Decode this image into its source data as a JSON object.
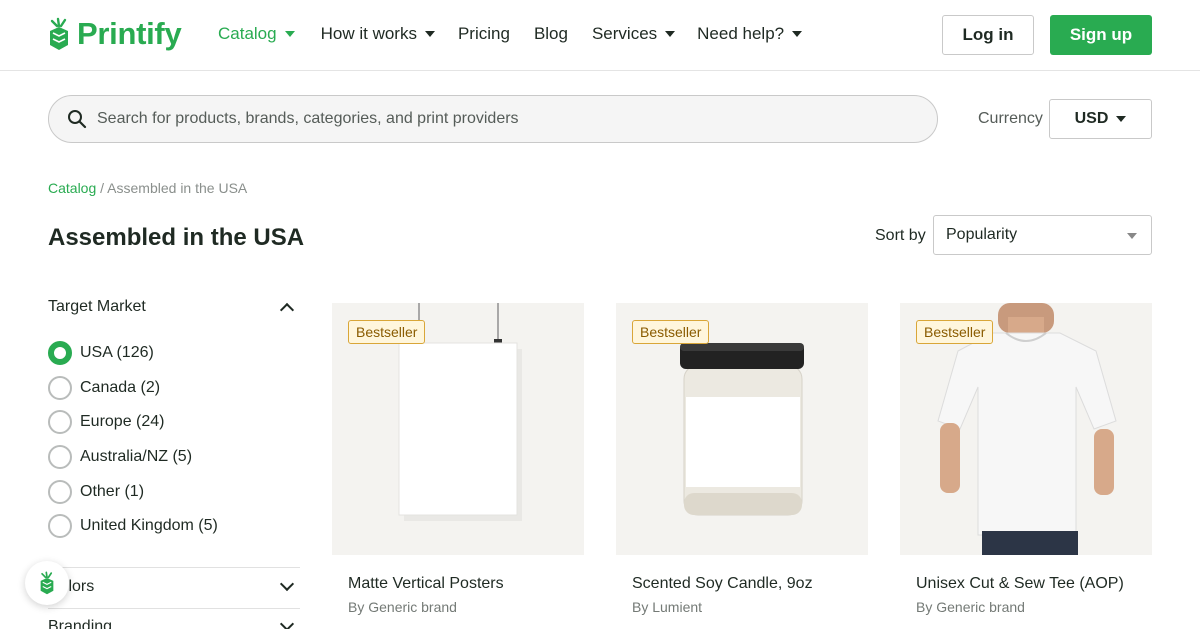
{
  "header": {
    "logo_text": "Printify",
    "nav": [
      {
        "label": "Catalog",
        "has_dropdown": true,
        "active": true
      },
      {
        "label": "How it works",
        "has_dropdown": true,
        "active": false
      },
      {
        "label": "Pricing",
        "has_dropdown": false,
        "active": false
      },
      {
        "label": "Blog",
        "has_dropdown": false,
        "active": false
      },
      {
        "label": "Services",
        "has_dropdown": true,
        "active": false
      },
      {
        "label": "Need help?",
        "has_dropdown": true,
        "active": false
      }
    ],
    "login_label": "Log in",
    "signup_label": "Sign up"
  },
  "search": {
    "placeholder": "Search for products, brands, categories, and print providers",
    "value": ""
  },
  "currency": {
    "label": "Currency",
    "value": "USD"
  },
  "breadcrumb": {
    "root": "Catalog",
    "separator": "/",
    "current": "Assembled in the USA"
  },
  "page_title": "Assembled in the USA",
  "sort": {
    "label": "Sort by",
    "value": "Popularity"
  },
  "filters": {
    "target_market": {
      "title": "Target Market",
      "options": [
        {
          "label": "USA (126)",
          "checked": true
        },
        {
          "label": "Canada (2)",
          "checked": false
        },
        {
          "label": "Europe (24)",
          "checked": false
        },
        {
          "label": "Australia/NZ (5)",
          "checked": false
        },
        {
          "label": "Other (1)",
          "checked": false
        },
        {
          "label": "United Kingdom (5)",
          "checked": false
        }
      ]
    },
    "colors_title": "Colors",
    "branding_title": "Branding"
  },
  "products": [
    {
      "badge": "Bestseller",
      "name": "Matte Vertical Posters",
      "brand": "By Generic brand",
      "image": "poster"
    },
    {
      "badge": "Bestseller",
      "name": "Scented Soy Candle, 9oz",
      "brand": "By Lumient",
      "image": "candle"
    },
    {
      "badge": "Bestseller",
      "name": "Unisex Cut & Sew Tee (AOP)",
      "brand": "By Generic brand",
      "image": "tshirt"
    }
  ],
  "colors": {
    "accent": "#29ab51",
    "badge_border": "#d9a638",
    "badge_bg": "#fff6dc"
  }
}
